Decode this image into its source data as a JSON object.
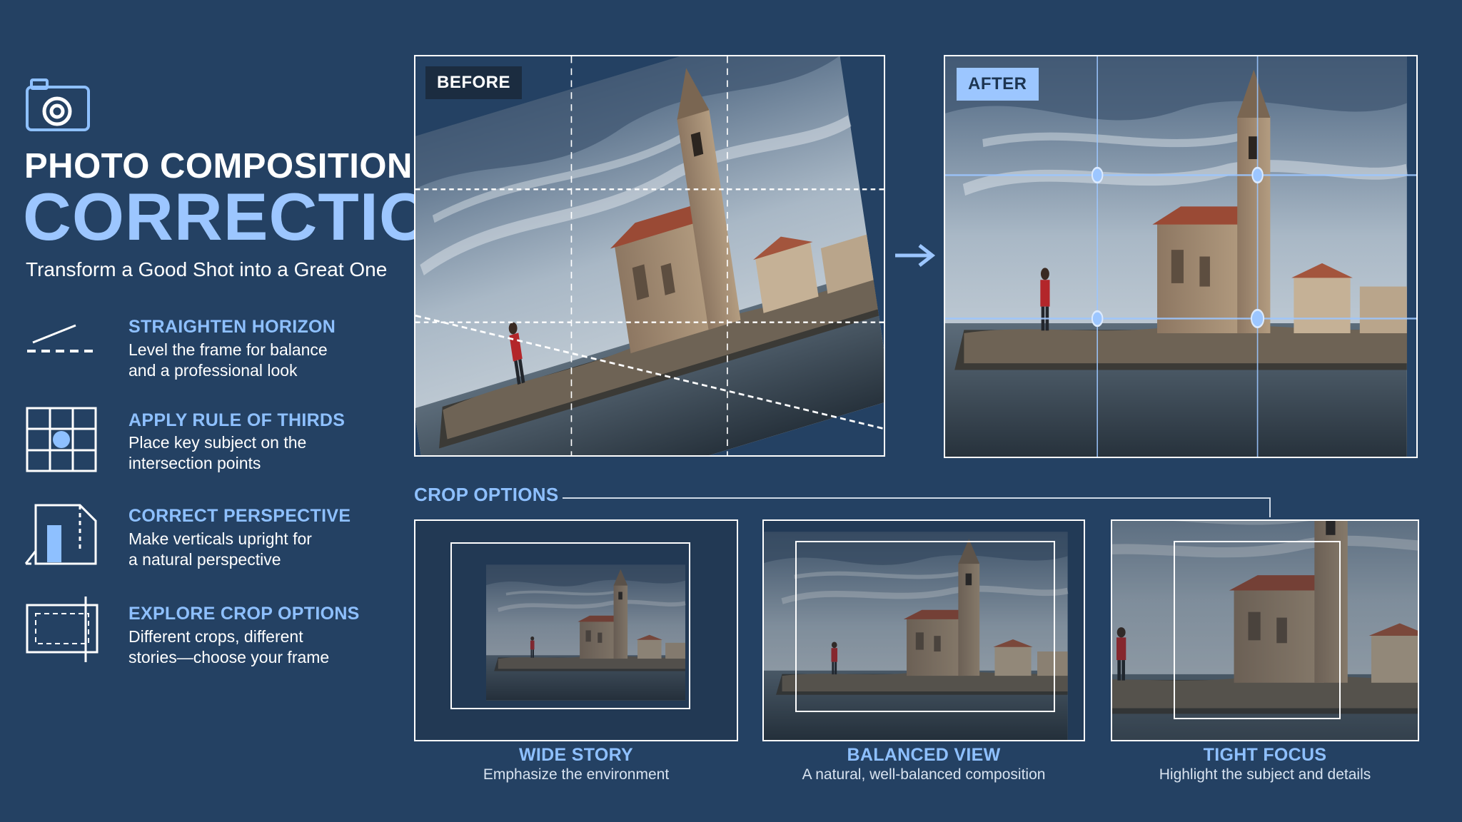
{
  "header": {
    "icon": "camera-icon",
    "title_line1": "PHOTO COMPOSITION",
    "title_line2": "CORRECTION",
    "subtitle": "Transform a Good Shot into a Great One"
  },
  "steps": [
    {
      "icon": "horizon-line-icon",
      "title": "STRAIGHTEN HORIZON",
      "desc_line1": "Level the frame for balance",
      "desc_line2": "and a professional look"
    },
    {
      "icon": "rule-of-thirds-grid-icon",
      "title": "APPLY RULE OF THIRDS",
      "desc_line1": "Place key subject on the",
      "desc_line2": "intersection points"
    },
    {
      "icon": "perspective-box-icon",
      "title": "CORRECT PERSPECTIVE",
      "desc_line1": "Make verticals upright for",
      "desc_line2": "a natural perspective"
    },
    {
      "icon": "crop-frame-icon",
      "title": "EXPLORE CROP OPTIONS",
      "desc_line1": "Different crops, different",
      "desc_line2": "stories—choose your frame"
    }
  ],
  "before": {
    "badge": "BEFORE"
  },
  "after": {
    "badge": "AFTER"
  },
  "crop_section": {
    "heading": "CROP OPTIONS",
    "options": [
      {
        "label": "WIDE STORY",
        "desc": "Emphasize the environment"
      },
      {
        "label": "BALANCED VIEW",
        "desc": "A natural, well-balanced composition"
      },
      {
        "label": "TIGHT FOCUS",
        "desc": "Highlight the subject and details"
      }
    ]
  },
  "colors": {
    "background": "#244163",
    "accent": "#9cc6ff",
    "accent_label": "#8ec0ff",
    "grid_line": "#9cc6ff"
  }
}
